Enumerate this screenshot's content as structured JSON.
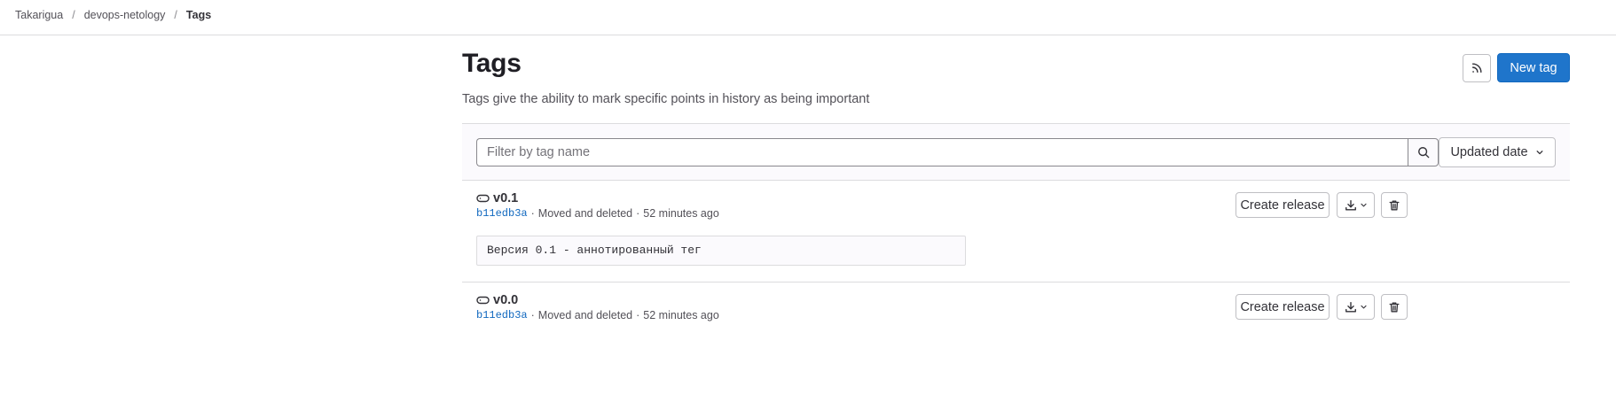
{
  "breadcrumb": {
    "items": [
      "Takarigua",
      "devops-netology"
    ],
    "current": "Tags",
    "separator": "/"
  },
  "header": {
    "title": "Tags",
    "description": "Tags give the ability to mark specific points in history as being important",
    "rss_icon": "rss-icon",
    "new_tag_label": "New tag"
  },
  "filter": {
    "placeholder": "Filter by tag name",
    "value": "",
    "search_icon": "search-icon",
    "sort_label": "Updated date",
    "sort_icon": "chevron-down-icon"
  },
  "tags": [
    {
      "name": "v0.1",
      "icon": "tag-icon",
      "commit": "b11edb3a",
      "separator": "·",
      "commit_message": "Moved and deleted",
      "time": "52 minutes ago",
      "message": "Версия 0.1 - аннотированный тег",
      "create_release_label": "Create release",
      "download_icon": "download-icon",
      "delete_icon": "trash-icon"
    },
    {
      "name": "v0.0",
      "icon": "tag-icon",
      "commit": "b11edb3a",
      "separator": "·",
      "commit_message": "Moved and deleted",
      "time": "52 minutes ago",
      "create_release_label": "Create release",
      "download_icon": "download-icon",
      "delete_icon": "trash-icon"
    }
  ],
  "colors": {
    "primary": "#1f75cb",
    "link": "#1068bf",
    "border": "#dcdcde",
    "text": "#333238",
    "muted": "#535158"
  }
}
